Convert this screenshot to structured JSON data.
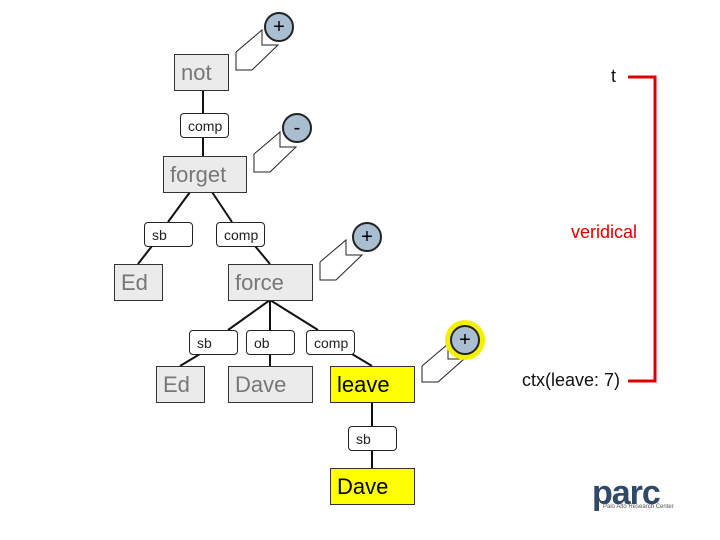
{
  "nodes": {
    "not": "not",
    "forget": "forget",
    "ed1": "Ed",
    "force": "force",
    "ed2": "Ed",
    "dave1": "Dave",
    "leave": "leave",
    "dave2": "Dave"
  },
  "labels": {
    "comp1": "comp",
    "sb1": "sb",
    "comp2": "comp",
    "sb2": "sb",
    "ob": "ob",
    "comp3": "comp",
    "sb3": "sb"
  },
  "markers": {
    "m1": "+",
    "m2": "-",
    "m3": "+",
    "m4": "+"
  },
  "annotations": {
    "t": "t",
    "veridical": "veridical",
    "ctx": "ctx(leave: 7)"
  },
  "logo": {
    "name": "parc",
    "subtitle": "Palo Alto Research Center"
  },
  "colors": {
    "highlight": "#ffff00",
    "bracket": "#d00000",
    "marker": "#a9bfd1",
    "logo": "#2f4a66"
  }
}
